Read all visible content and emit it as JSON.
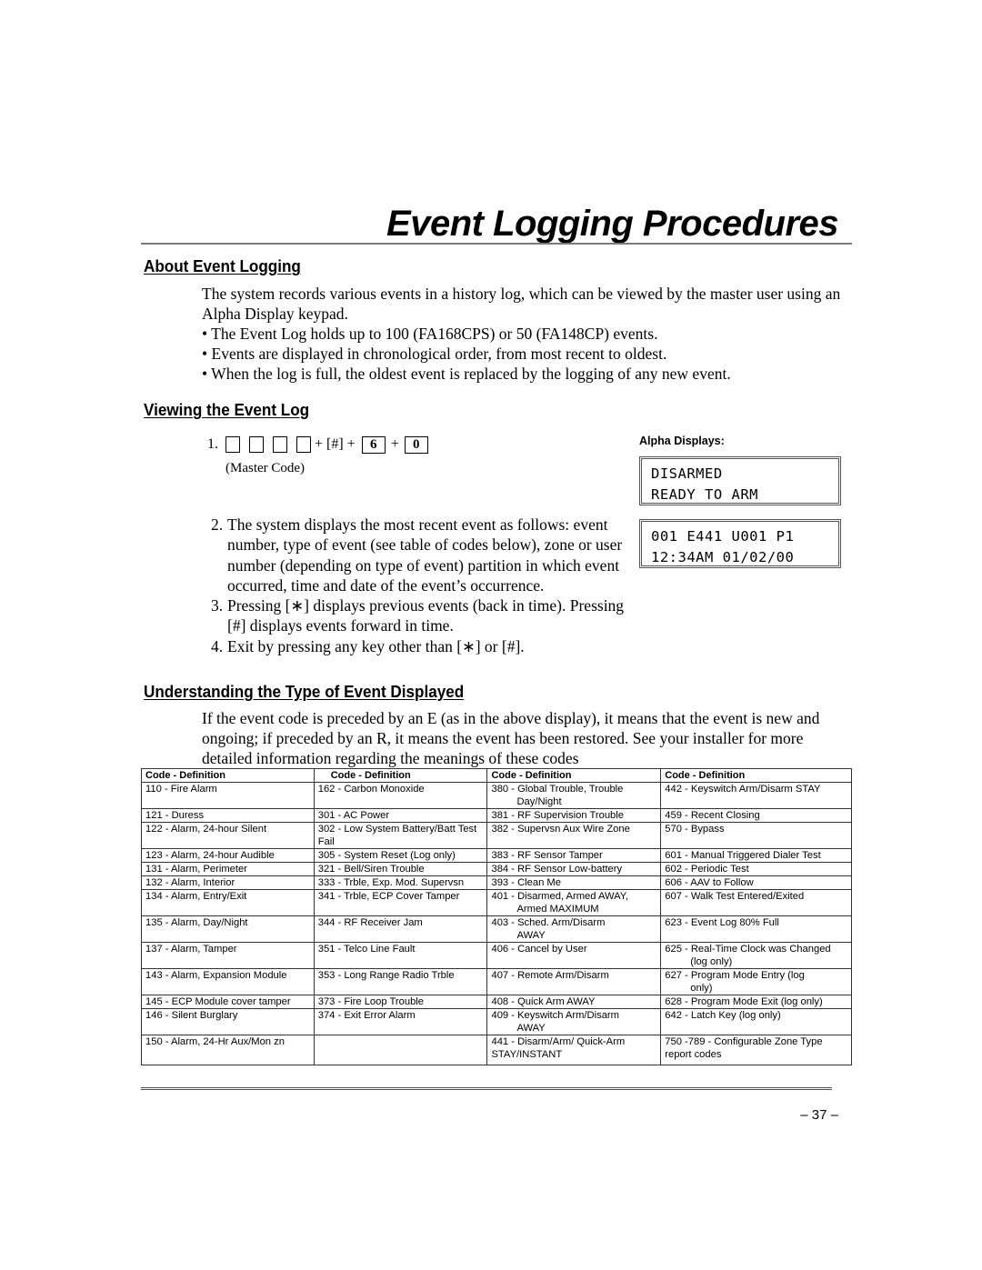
{
  "page": {
    "title": "Event Logging Procedures",
    "page_number": "– 37 –"
  },
  "about": {
    "heading": "About Event Logging",
    "intro": "The system records various events in a history log, which can be viewed by the master user using an Alpha Display keypad.",
    "bullets": [
      "• The Event Log holds up to 100 (FA168CPS) or 50 (FA148CP) events.",
      "• Events are displayed in chronological order, from most recent to oldest.",
      "• When the log is full, the oldest event is replaced by the logging of any new event."
    ]
  },
  "viewing": {
    "heading": "Viewing the Event Log",
    "step1": {
      "number": "1.",
      "hash_key": "+ [#] +",
      "plus": "+",
      "digit1": "6",
      "digit2": "0",
      "master_code_label": "(Master Code)"
    },
    "steps": [
      {
        "number": "2.",
        "text": "The system displays the most recent event as follows: event number, type of event (see table of codes below), zone or user number (depending on type of event) partition in which event occurred, time and date of the event’s occurrence."
      },
      {
        "number": "3.",
        "text": "Pressing [∗] displays previous events (back in time). Pressing [#] displays events forward in time."
      },
      {
        "number": "4.",
        "text": "Exit by pressing any key other than [∗] or [#]."
      }
    ],
    "alpha_displays": {
      "label": "Alpha Displays:",
      "display1": {
        "line1": "DISARMED",
        "line2": "READY TO ARM"
      },
      "display2": {
        "line1": "001 E441 U001 P1",
        "line2": "12:34AM 01/02/00"
      }
    }
  },
  "understanding": {
    "heading": "Understanding the Type of Event Displayed",
    "paragraph": "If the event code is preceded by an E (as in the above display), it means that the event is new and ongoing; if preceded by an R, it means the event has been restored. See your installer for more detailed information regarding the meanings of these codes"
  },
  "codes_table": {
    "headers": [
      "Code - Definition",
      "Code - Definition",
      "Code - Definition",
      "Code - Definition"
    ],
    "rows": [
      [
        "110 - Fire Alarm",
        "162 - Carbon Monoxide",
        "380 - Global Trouble, Trouble|Day/Night",
        "442 - Keyswitch Arm/Disarm STAY"
      ],
      [
        "121 - Duress",
        "301 - AC Power",
        "381 - RF Supervision Trouble",
        "459 - Recent Closing"
      ],
      [
        "122 - Alarm, 24-hour Silent",
        "302 - Low System Battery/Batt Test Fail",
        "382 - Supervsn Aux Wire Zone",
        "570 - Bypass"
      ],
      [
        "123 - Alarm, 24-hour Audible",
        "305 - System Reset (Log only)",
        "383 - RF Sensor Tamper",
        "601 - Manual Triggered Dialer Test"
      ],
      [
        "131 - Alarm, Perimeter",
        "321 - Bell/Siren Trouble",
        "384 - RF Sensor Low-battery",
        "602 - Periodic Test"
      ],
      [
        "132 - Alarm, Interior",
        "333 - Trble, Exp. Mod. Supervsn",
        "393 - Clean Me",
        "606 - AAV to Follow"
      ],
      [
        "134 - Alarm, Entry/Exit",
        "341 - Trble, ECP Cover Tamper",
        "401 - Disarmed, Armed AWAY,|Armed MAXIMUM",
        "607 - Walk Test Entered/Exited"
      ],
      [
        "135 - Alarm, Day/Night",
        "344 - RF Receiver Jam",
        "403 - Sched. Arm/Disarm|AWAY",
        "623 - Event Log 80% Full"
      ],
      [
        "137 - Alarm, Tamper",
        "351 - Telco Line Fault",
        "406 - Cancel by User",
        "625 - Real-Time Clock was Changed|(log only)"
      ],
      [
        "143 - Alarm, Expansion Module",
        "353 - Long Range Radio Trble",
        "407 - Remote Arm/Disarm",
        "627 - Program Mode Entry (log|only)"
      ],
      [
        "145 - ECP Module cover tamper",
        "373 - Fire Loop Trouble",
        "408 - Quick Arm AWAY",
        "628 - Program Mode Exit (log only)"
      ],
      [
        "146 - Silent Burglary",
        "374 - Exit Error Alarm",
        "409 - Keyswitch Arm/Disarm|AWAY",
        "642 - Latch Key (log only)"
      ],
      [
        "150 - Alarm, 24-Hr Aux/Mon zn",
        "",
        "441 - Disarm/Arm/ Quick-Arm STAY/INSTANT",
        "750 -789 - Configurable Zone Type report codes"
      ]
    ]
  }
}
